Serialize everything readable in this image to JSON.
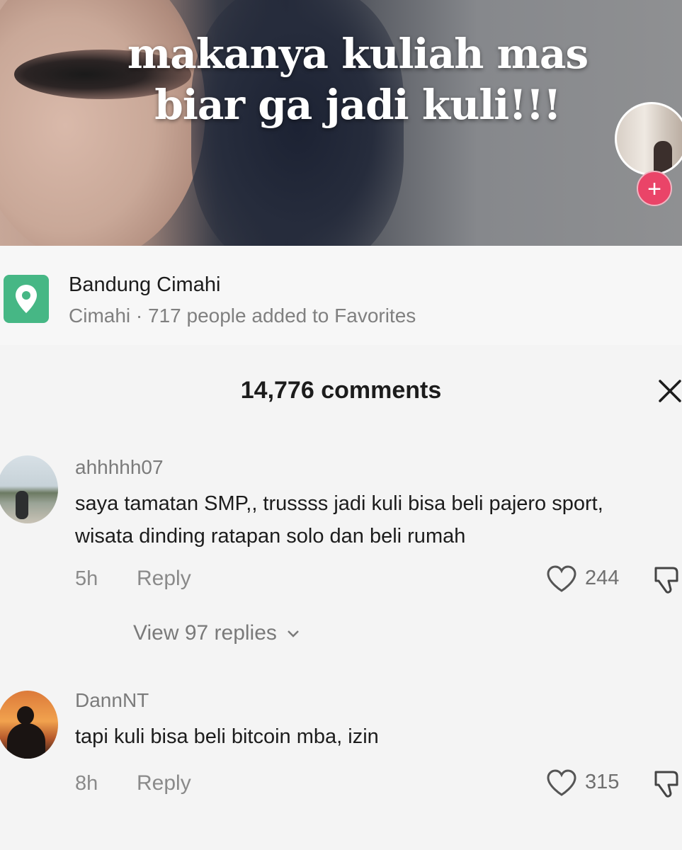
{
  "video": {
    "caption_line1": "makanya kuliah mas",
    "caption_line2": "biar ga jadi kuli!!!",
    "follow_symbol": "+"
  },
  "location": {
    "icon": "location-pin-icon",
    "title": "Bandung Cimahi",
    "subtitle": "Cimahi · 717 people added to Favorites"
  },
  "comments_header": {
    "count_label": "14,776 comments",
    "close_icon": "close-icon"
  },
  "comments": [
    {
      "username": "ahhhhh07",
      "text_line1": "saya tamatan SMP,, trussss jadi kuli bisa beli pajero sport,",
      "text_line2": "wisata dinding ratapan solo dan beli rumah",
      "time": "5h",
      "reply_label": "Reply",
      "likes": "244",
      "view_replies": "View 97 replies"
    },
    {
      "username": "DannNT",
      "text_line1": "tapi kuli bisa beli bitcoin mba, izin",
      "time": "8h",
      "reply_label": "Reply",
      "likes": "315"
    }
  ],
  "colors": {
    "follow_button": "#ea4468",
    "location_icon": "#46b785",
    "text_primary": "#1c1c1c",
    "text_secondary": "#808080"
  }
}
